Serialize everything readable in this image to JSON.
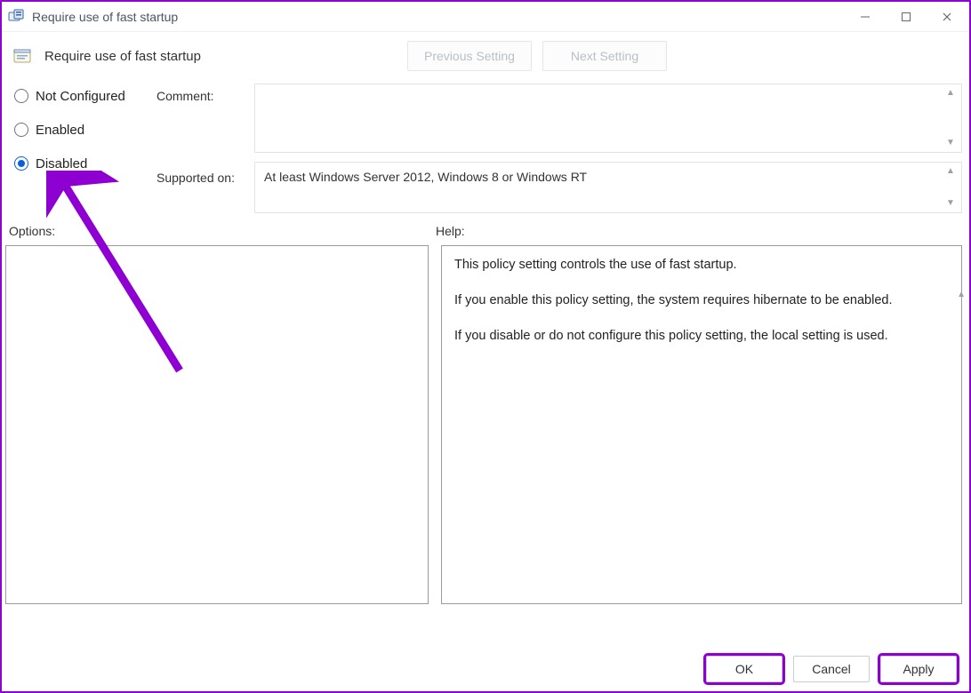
{
  "window": {
    "title": "Require use of fast startup"
  },
  "header": {
    "setting_name": "Require use of fast startup",
    "prev_btn": "Previous Setting",
    "next_btn": "Next Setting"
  },
  "form": {
    "radios": {
      "not_configured": "Not Configured",
      "enabled": "Enabled",
      "disabled": "Disabled",
      "selected": "disabled"
    },
    "comment_label": "Comment:",
    "comment_value": "",
    "supported_label": "Supported on:",
    "supported_value": "At least Windows Server 2012, Windows 8 or Windows RT"
  },
  "sections": {
    "options_label": "Options:",
    "help_label": "Help:"
  },
  "help": {
    "p1": "This policy setting controls the use of fast startup.",
    "p2": "If you enable this policy setting, the system requires hibernate to be enabled.",
    "p3": "If you disable or do not configure this policy setting, the local setting is used."
  },
  "footer": {
    "ok": "OK",
    "cancel": "Cancel",
    "apply": "Apply"
  }
}
